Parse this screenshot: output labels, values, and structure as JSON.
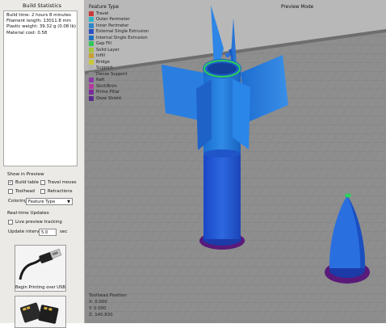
{
  "left_panel": {
    "title": "Build Statistics",
    "stats": [
      "Build time: 2 hours 8 minutes",
      "Filament length: 13011.8 mm",
      "Plastic weight: 39.32 g (0.08 lb)",
      "Material cost: 0.58"
    ],
    "show_in_preview": {
      "label": "Show in Preview",
      "build_table": "Build table",
      "build_table_checked": "✓",
      "travel_moves": "Travel moves",
      "toolhead": "Toolhead",
      "retractions": "Retractions",
      "coloring_label": "Coloring",
      "coloring_value": "Feature Type"
    },
    "realtime": {
      "label": "Real-time Updates",
      "live_preview": "Live preview tracking",
      "interval_label": "Update interval",
      "interval_value": "5.0",
      "interval_unit": "sec"
    },
    "usb_button": "Begin Printing over USB"
  },
  "viewport": {
    "mode_label": "Preview Mode",
    "legend_title": "Feature Type",
    "legend": [
      {
        "label": "Travel",
        "color": "#c83a3a"
      },
      {
        "label": "Outer Perimeter",
        "color": "#2db6c8"
      },
      {
        "label": "Inner Perimeter",
        "color": "#2d86c8"
      },
      {
        "label": "External Single Extrusion",
        "color": "#2a4fc2"
      },
      {
        "label": "Internal Single Extrusion",
        "color": "#1f6fbe"
      },
      {
        "label": "Gap Fill",
        "color": "#2fc85a"
      },
      {
        "label": "Solid Layer",
        "color": "#a6c43a"
      },
      {
        "label": "Infill",
        "color": "#c8a030"
      },
      {
        "label": "Bridge",
        "color": "#c8c83a"
      },
      {
        "label": "Support",
        "color": "#b0b0b0"
      },
      {
        "label": "Dense Support",
        "color": "#8a8a8a"
      },
      {
        "label": "Raft",
        "color": "#8a3aa8"
      },
      {
        "label": "Skirt/Brim",
        "color": "#b43aa0"
      },
      {
        "label": "Prime Pillar",
        "color": "#7a2a9a"
      },
      {
        "label": "Ooze Shield",
        "color": "#5a2a8a"
      }
    ],
    "toolhead": {
      "title": "Toolhead Position",
      "x": "X: 0.000",
      "y": "Y: 0.000",
      "z": "Z: 140.830"
    }
  }
}
